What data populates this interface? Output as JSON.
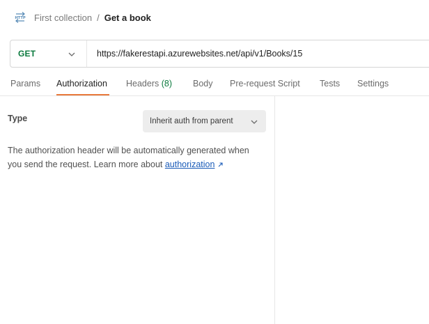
{
  "breadcrumb": {
    "icon": "http-request-icon",
    "parent": "First collection",
    "separator": "/",
    "current": "Get a book"
  },
  "request": {
    "method": "GET",
    "url": "https://fakerestapi.azurewebsites.net/api/v1/Books/15"
  },
  "tabs": {
    "params": "Params",
    "authorization": "Authorization",
    "headers": "Headers",
    "headers_count": "(8)",
    "body": "Body",
    "pre_request_script": "Pre-request Script",
    "tests": "Tests",
    "settings": "Settings",
    "active": "Authorization"
  },
  "auth": {
    "type_label": "Type",
    "selected_type": "Inherit auth from parent",
    "description_line1": "The authorization header will be automatically generated when",
    "description_line2_prefix": "you send the request. Learn more about ",
    "link_text": "authorization"
  },
  "colors": {
    "method_get": "#0b7a3e",
    "active_tab_underline": "#e8783a",
    "link": "#1a5bb8",
    "headers_count": "#0b7a3e"
  }
}
